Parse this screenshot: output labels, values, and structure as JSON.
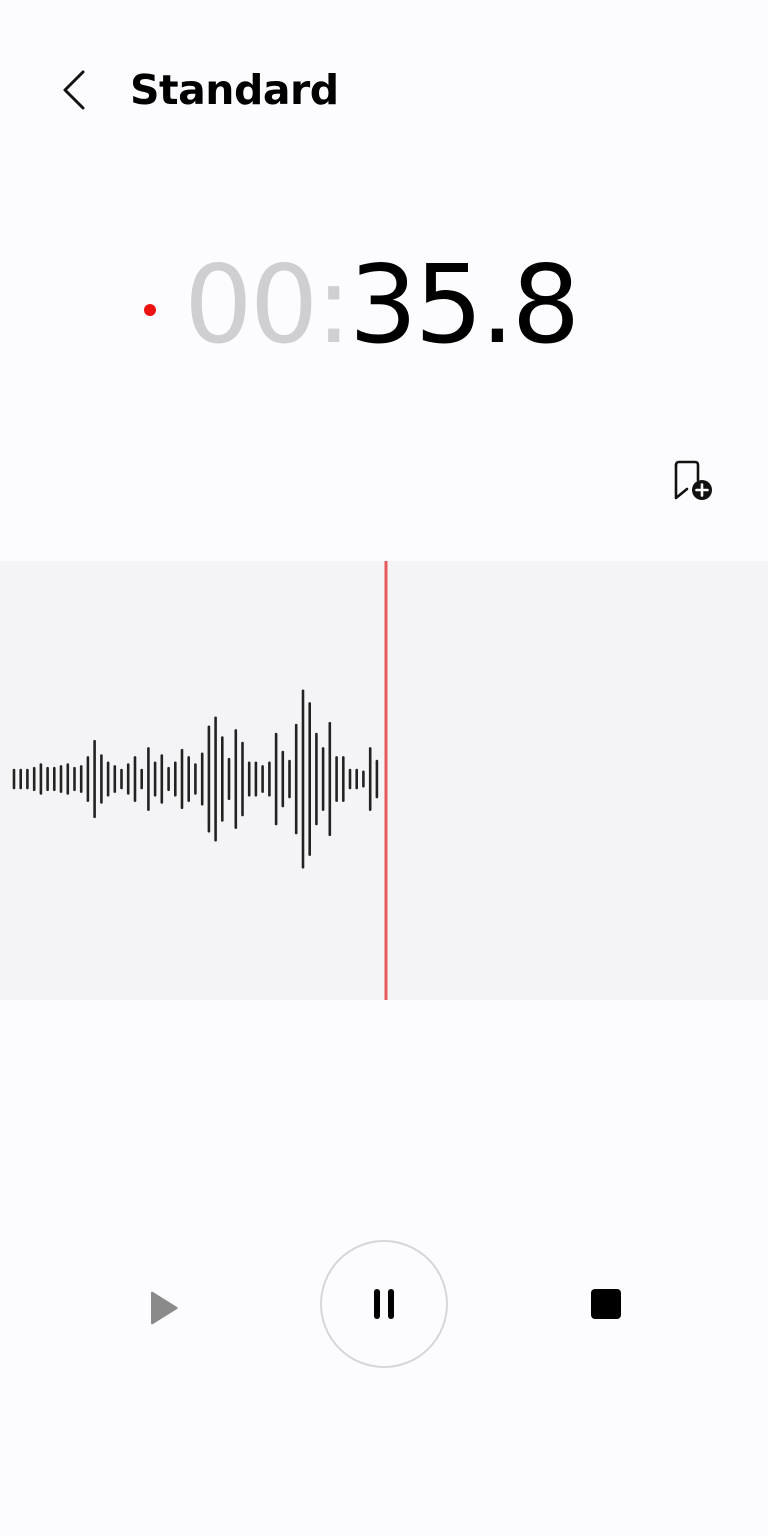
{
  "header": {
    "title": "Standard",
    "back_icon": "chevron-left-icon"
  },
  "timer": {
    "minutes": "00",
    "separator": ":",
    "seconds": "35.8",
    "recording_indicator_color": "#ee1111"
  },
  "bookmark": {
    "icon": "add-bookmark-icon"
  },
  "waveform": {
    "background_color": "#f4f4f6",
    "bar_color": "#222222",
    "playhead_color": "#e85a5a",
    "amplitudes": [
      0.05,
      0.05,
      0.05,
      0.06,
      0.08,
      0.06,
      0.06,
      0.07,
      0.08,
      0.06,
      0.07,
      0.12,
      0.21,
      0.13,
      0.09,
      0.07,
      0.05,
      0.08,
      0.12,
      0.05,
      0.17,
      0.09,
      0.13,
      0.06,
      0.09,
      0.16,
      0.12,
      0.08,
      0.14,
      0.29,
      0.34,
      0.23,
      0.11,
      0.27,
      0.2,
      0.09,
      0.09,
      0.07,
      0.09,
      0.25,
      0.15,
      0.1,
      0.3,
      0.49,
      0.42,
      0.25,
      0.17,
      0.31,
      0.12,
      0.12,
      0.05,
      0.05,
      0.04,
      0.17,
      0.1
    ]
  },
  "controls": {
    "play_icon": "play-icon",
    "pause_icon": "pause-icon",
    "stop_icon": "stop-icon",
    "play_color": "#8a8a8a",
    "pause_ring_color": "#d6d6d8"
  }
}
